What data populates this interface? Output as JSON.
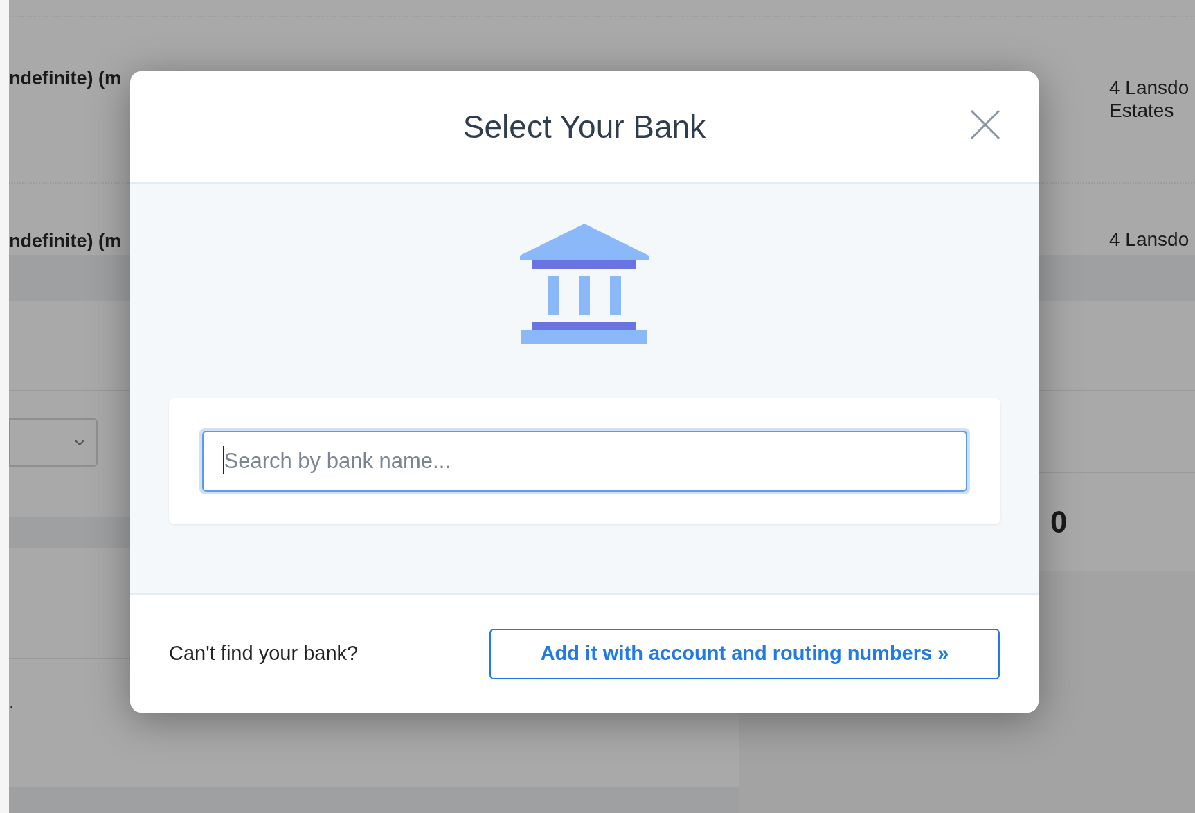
{
  "background": {
    "rows": [
      {
        "text_left": "ndefinite) (m",
        "address_lines": [
          "4 Lansdo",
          "Estates"
        ]
      },
      {
        "text_left": "ndefinite) (m",
        "address_lines": [
          "4 Lansdo"
        ]
      }
    ],
    "dot_text": ".",
    "amount": "0"
  },
  "dialog": {
    "title": "Select Your Bank",
    "search": {
      "placeholder": "Search by bank name..."
    },
    "footer": {
      "prompt": "Can't find your bank?",
      "button": "Add it with account and routing numbers »"
    }
  }
}
